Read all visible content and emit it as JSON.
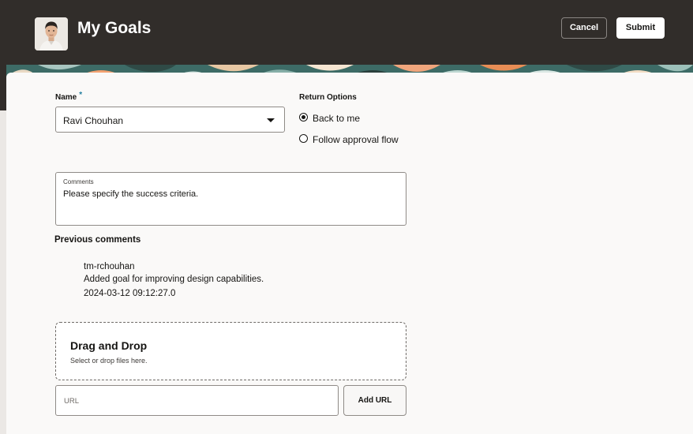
{
  "header": {
    "title": "My Goals",
    "cancel_label": "Cancel",
    "submit_label": "Submit"
  },
  "form": {
    "name_label": "Name",
    "required_marker": "*",
    "name_value": "Ravi Chouhan",
    "return_options": {
      "label": "Return Options",
      "options": [
        {
          "label": "Back to me",
          "selected": true
        },
        {
          "label": "Follow approval flow",
          "selected": false
        }
      ]
    },
    "comments": {
      "label": "Comments",
      "value": "Please specify the success criteria."
    }
  },
  "previous_comments": {
    "title": "Previous comments",
    "items": [
      {
        "author": "tm-rchouhan",
        "text": "Added goal for improving design capabilities.",
        "timestamp": "2024-03-12 09:12:27.0"
      }
    ]
  },
  "attachments": {
    "drop_title": "Drag and Drop",
    "drop_subtitle": "Select or drop files here.",
    "url_placeholder": "URL",
    "add_url_label": "Add URL"
  },
  "colors": {
    "header_bg": "#312d2a",
    "required_accent": "#227e9e",
    "panel_bg": "#faf9f8"
  },
  "icons": [
    "avatar-image",
    "chevron-down-icon",
    "radio-icon"
  ]
}
